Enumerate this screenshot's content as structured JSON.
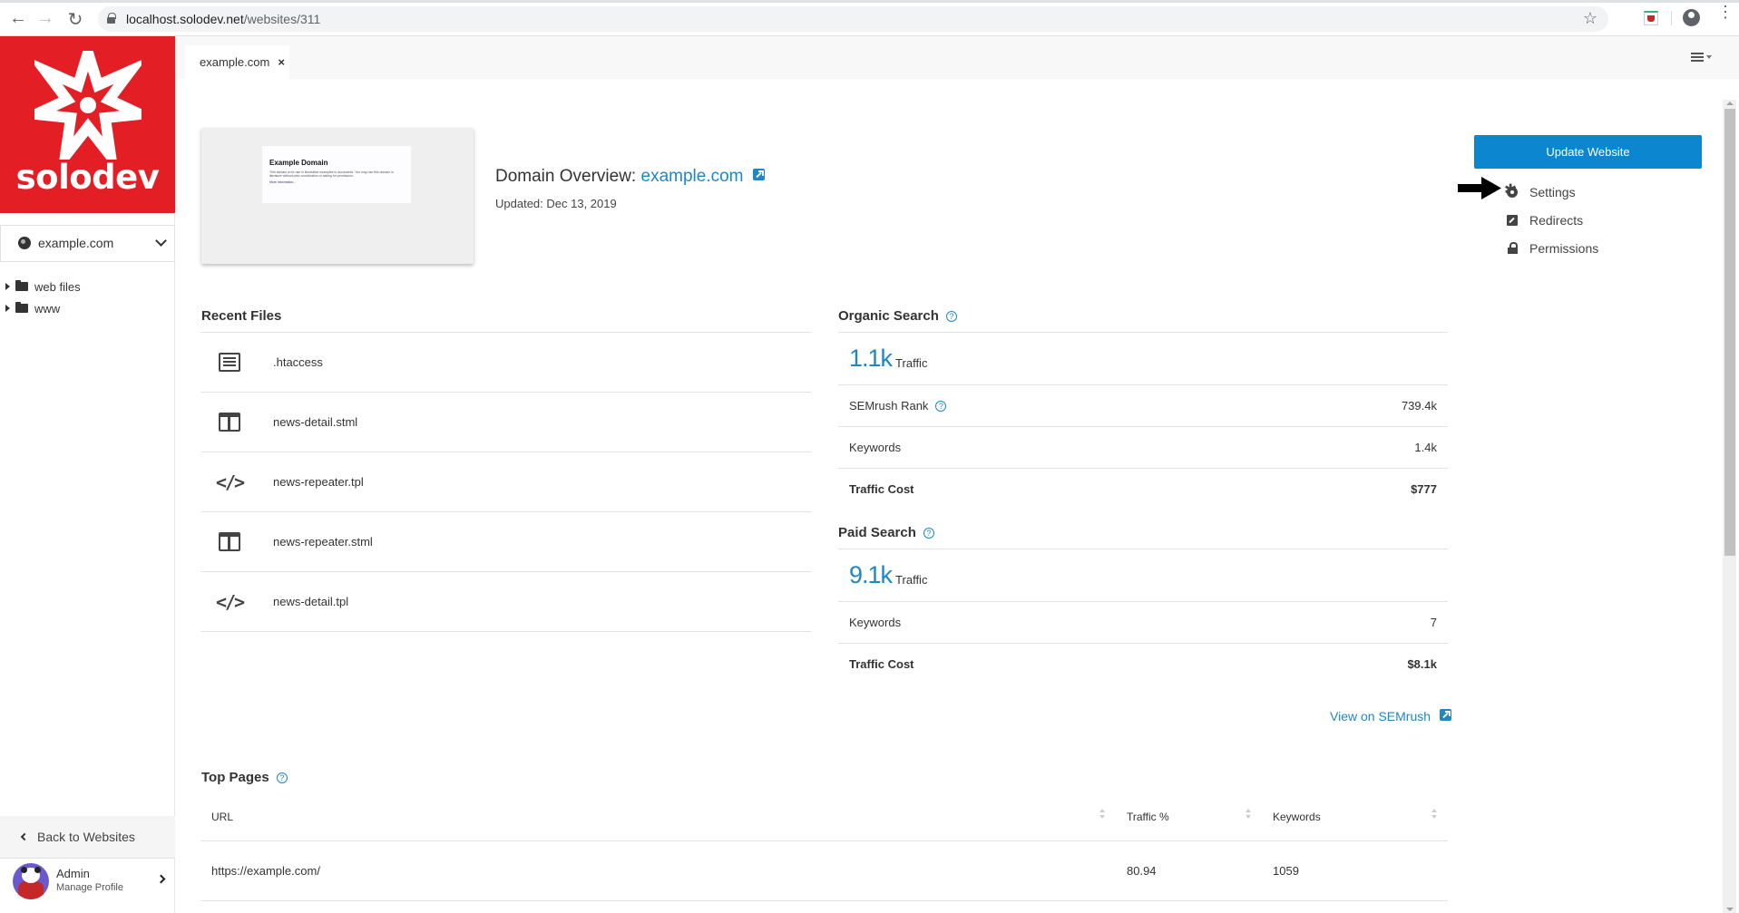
{
  "browser": {
    "url_host": "localhost.solodev.net",
    "url_path": "/websites/311"
  },
  "sidebar": {
    "brand": "solodev",
    "site_selector": "example.com",
    "tree": [
      {
        "label": "web files"
      },
      {
        "label": "www"
      }
    ],
    "back_label": "Back to Websites",
    "profile": {
      "name": "Admin",
      "subtitle": "Manage Profile"
    }
  },
  "tabs": [
    {
      "label": "example.com",
      "close": "×"
    }
  ],
  "header": {
    "thumbnail": {
      "title": "Example Domain",
      "body": "This domain is for use in illustrative examples in documents. You may use this domain in literature without prior coordination or asking for permission.",
      "link": "More information..."
    },
    "title_prefix": "Domain Overview:",
    "domain": "example.com",
    "updated": "Updated: Dec 13, 2019"
  },
  "actions": {
    "update_button": "Update Website",
    "items": [
      {
        "label": "Settings",
        "icon": "gear-icon"
      },
      {
        "label": "Redirects",
        "icon": "redirect-icon"
      },
      {
        "label": "Permissions",
        "icon": "lock-icon"
      }
    ]
  },
  "recent_files": {
    "title": "Recent Files",
    "items": [
      {
        "name": ".htaccess",
        "icon": "list-file-icon"
      },
      {
        "name": "news-detail.stml",
        "icon": "layout-file-icon"
      },
      {
        "name": "news-repeater.tpl",
        "icon": "code-file-icon"
      },
      {
        "name": "news-repeater.stml",
        "icon": "layout-file-icon"
      },
      {
        "name": "news-detail.tpl",
        "icon": "code-file-icon"
      }
    ]
  },
  "organic": {
    "title": "Organic Search",
    "traffic_value": "1.1k",
    "traffic_label": "Traffic",
    "rows": [
      {
        "label": "SEMrush Rank",
        "value": "739.4k",
        "help": true
      },
      {
        "label": "Keywords",
        "value": "1.4k"
      },
      {
        "label": "Traffic Cost",
        "value": "$777"
      }
    ]
  },
  "paid": {
    "title": "Paid Search",
    "traffic_value": "9.1k",
    "traffic_label": "Traffic",
    "rows": [
      {
        "label": "Keywords",
        "value": "7"
      },
      {
        "label": "Traffic Cost",
        "value": "$8.1k"
      }
    ]
  },
  "semrush_link": "View on SEMrush",
  "top_pages": {
    "title": "Top Pages",
    "columns": [
      "URL",
      "Traffic %",
      "Keywords"
    ],
    "rows": [
      {
        "url": "https://example.com/",
        "traffic": "80.94",
        "keywords": "1059"
      }
    ]
  },
  "colors": {
    "brand_red": "#e31e24",
    "accent_blue": "#1e87c4",
    "button_blue": "#0d86d0"
  }
}
